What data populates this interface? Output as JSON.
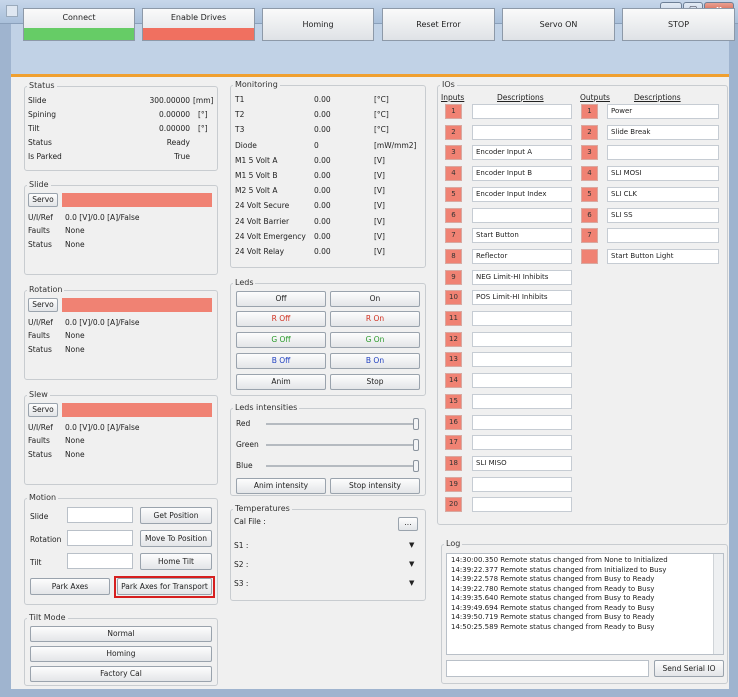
{
  "window": {
    "minimize": "–",
    "maximize": "▢",
    "close": "x"
  },
  "toolbar": {
    "connect": "Connect",
    "enable_drives": "Enable Drives",
    "homing": "Homing",
    "reset_error": "Reset Error",
    "servo_on": "Servo ON",
    "stop": "STOP",
    "connect_status_color": "#66cc66",
    "enable_status_color": "#f07060"
  },
  "status": {
    "title": "Status",
    "rows": [
      {
        "label": "Slide",
        "value": "300.00000",
        "unit": "[mm]"
      },
      {
        "label": "Spining",
        "value": "0.00000",
        "unit": "[°]"
      },
      {
        "label": "Tilt",
        "value": "0.00000",
        "unit": "[°]"
      },
      {
        "label": "Status",
        "value": "Ready",
        "unit": ""
      },
      {
        "label": "Is Parked",
        "value": "True",
        "unit": ""
      }
    ]
  },
  "slide": {
    "title": "Slide",
    "servo": "Servo",
    "uiref_label": "U/I/Ref",
    "uiref_value": "0.0 [V]/0.0 [A]/False",
    "faults_label": "Faults",
    "faults_value": "None",
    "status_label": "Status",
    "status_value": "None"
  },
  "rotation": {
    "title": "Rotation",
    "servo": "Servo",
    "uiref_label": "U/I/Ref",
    "uiref_value": "0.0 [V]/0.0 [A]/False",
    "faults_label": "Faults",
    "faults_value": "None",
    "status_label": "Status",
    "status_value": "None"
  },
  "slew": {
    "title": "Slew",
    "servo": "Servo",
    "uiref_label": "U/I/Ref",
    "uiref_value": "0.0 [V]/0.0 [A]/False",
    "faults_label": "Faults",
    "faults_value": "None",
    "status_label": "Status",
    "status_value": "None"
  },
  "motion": {
    "title": "Motion",
    "slide_label": "Slide",
    "rotation_label": "Rotation",
    "tilt_label": "Tilt",
    "get_position": "Get Position",
    "move_to_position": "Move To Position",
    "home_tilt": "Home Tilt",
    "park_axes": "Park Axes",
    "park_axes_transport": "Park Axes for Transport"
  },
  "tilt_mode": {
    "title": "Tilt Mode",
    "normal": "Normal",
    "homing": "Homing",
    "factory_cal": "Factory Cal"
  },
  "monitoring": {
    "title": "Monitoring",
    "rows": [
      {
        "label": "T1",
        "value": "0.00",
        "unit": "[°C]"
      },
      {
        "label": "T2",
        "value": "0.00",
        "unit": "[°C]"
      },
      {
        "label": "T3",
        "value": "0.00",
        "unit": "[°C]"
      },
      {
        "label": "Diode",
        "value": "0",
        "unit": "[mW/mm2]"
      },
      {
        "label": "M1 5 Volt A",
        "value": "0.00",
        "unit": "[V]"
      },
      {
        "label": "M1 5 Volt B",
        "value": "0.00",
        "unit": "[V]"
      },
      {
        "label": "M2 5 Volt A",
        "value": "0.00",
        "unit": "[V]"
      },
      {
        "label": "24 Volt Secure",
        "value": "0.00",
        "unit": "[V]"
      },
      {
        "label": "24 Volt Barrier",
        "value": "0.00",
        "unit": "[V]"
      },
      {
        "label": "24 Volt Emergency",
        "value": "0.00",
        "unit": "[V]"
      },
      {
        "label": "24 Volt Relay",
        "value": "0.00",
        "unit": "[V]"
      }
    ]
  },
  "leds": {
    "title": "Leds",
    "off": "Off",
    "on": "On",
    "r_off": "R Off",
    "r_on": "R On",
    "g_off": "G Off",
    "g_on": "G On",
    "b_off": "B Off",
    "b_on": "B On",
    "anim": "Anim",
    "stop": "Stop",
    "red_color": "#d03020",
    "green_color": "#2a9a2a",
    "blue_color": "#2040c0"
  },
  "intensities": {
    "title": "Leds intensities",
    "red": "Red",
    "green": "Green",
    "blue": "Blue",
    "anim_intensity": "Anim intensity",
    "stop_intensity": "Stop intensity"
  },
  "temperatures": {
    "title": "Temperatures",
    "cal_file": "Cal File :",
    "browse": "...",
    "s1": "S1 :",
    "s2": "S2 :",
    "s3": "S3 :"
  },
  "ios": {
    "title": "IOs",
    "inputs_header": "Inputs",
    "descriptions_header": "Descriptions",
    "outputs_header": "Outputs",
    "outputs_descriptions_header": "Descriptions",
    "inputs": [
      {
        "n": "1",
        "d": ""
      },
      {
        "n": "2",
        "d": ""
      },
      {
        "n": "3",
        "d": "Encoder Input A"
      },
      {
        "n": "4",
        "d": "Encoder Input B"
      },
      {
        "n": "5",
        "d": "Encoder Input Index"
      },
      {
        "n": "6",
        "d": ""
      },
      {
        "n": "7",
        "d": "Start Button"
      },
      {
        "n": "8",
        "d": "Reflector"
      },
      {
        "n": "9",
        "d": "NEG Limit-HI Inhibits"
      },
      {
        "n": "10",
        "d": "POS Limit-HI Inhibits"
      },
      {
        "n": "11",
        "d": ""
      },
      {
        "n": "12",
        "d": ""
      },
      {
        "n": "13",
        "d": ""
      },
      {
        "n": "14",
        "d": ""
      },
      {
        "n": "15",
        "d": ""
      },
      {
        "n": "16",
        "d": ""
      },
      {
        "n": "17",
        "d": ""
      },
      {
        "n": "18",
        "d": "SLI MISO"
      },
      {
        "n": "19",
        "d": ""
      },
      {
        "n": "20",
        "d": ""
      }
    ],
    "outputs": [
      {
        "n": "1",
        "d": "Power"
      },
      {
        "n": "2",
        "d": "Slide Break"
      },
      {
        "n": "3",
        "d": ""
      },
      {
        "n": "4",
        "d": "SLI MOSI"
      },
      {
        "n": "5",
        "d": "SLI CLK"
      },
      {
        "n": "6",
        "d": "SLI SS"
      },
      {
        "n": "7",
        "d": ""
      },
      {
        "n": "",
        "d": "Start Button Light"
      }
    ]
  },
  "log": {
    "title": "Log",
    "lines": [
      "14:30:00.350 Remote status changed from None to Initialized",
      "14:39:22.377 Remote status changed from Initialized to Busy",
      "14:39:22.578 Remote status changed from Busy to Ready",
      "14:39:22.780 Remote status changed from Ready to Busy",
      "14:39:35.640 Remote status changed from Busy to Ready",
      "14:39:49.694 Remote status changed from Ready to Busy",
      "14:39:50.719 Remote status changed from Busy to Ready",
      "14:50:25.589 Remote status changed from Ready to Busy"
    ],
    "send_serial": "Send Serial IO",
    "serial_value": ""
  }
}
